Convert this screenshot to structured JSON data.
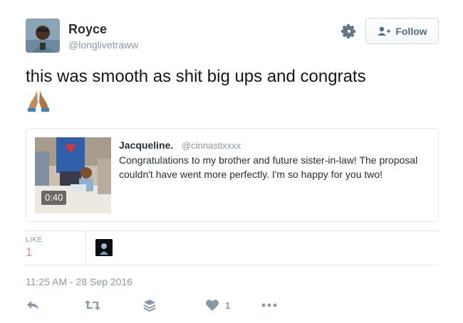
{
  "author": {
    "name": "Royce",
    "handle": "@longlivetraww"
  },
  "follow_button": {
    "label": "Follow"
  },
  "tweet": {
    "text": "this was smooth as shit big ups and congrats",
    "emoji": "folded-hands-emoji"
  },
  "quoted_tweet": {
    "name": "Jacqueline.",
    "handle": "@cinnastixxxx",
    "text": "Congratulations to my brother and future sister-in-law! The proposal couldn't have went more perfectly. I'm so happy for you two!",
    "video_duration": "0:40"
  },
  "stats": {
    "like_label": "LIKE",
    "like_count": "1"
  },
  "timestamp": "11:25 AM - 28 Sep 2016",
  "actions": {
    "like_count": "1"
  },
  "colors": {
    "text": "#14171a",
    "muted": "#8899a6",
    "border": "#e1e8ed",
    "like": "#e0245e",
    "follow_text": "#4f6d8a"
  }
}
